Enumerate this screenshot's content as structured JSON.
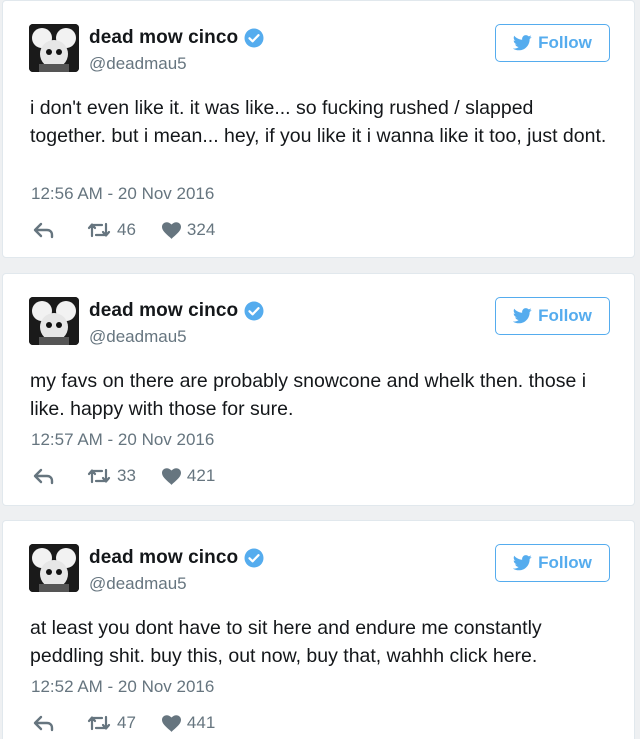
{
  "tweets": [
    {
      "name": "dead mow cinco",
      "handle": "@deadmau5",
      "follow_label": "Follow",
      "text": "i don't even like it. it was like... so fucking rushed / slapped together. but i mean... hey, if you like it i wanna like it too, just dont.",
      "timestamp": "12:56 AM - 20 Nov 2016",
      "retweets": "46",
      "likes": "324"
    },
    {
      "name": "dead mow cinco",
      "handle": "@deadmau5",
      "follow_label": "Follow",
      "text": "my favs on there are probably snowcone and whelk then. those i like. happy with those for sure.",
      "timestamp": "12:57 AM - 20 Nov 2016",
      "retweets": "33",
      "likes": "421"
    },
    {
      "name": "dead mow cinco",
      "handle": "@deadmau5",
      "follow_label": "Follow",
      "text": "at least you dont have to sit here and endure me constantly peddling shit. buy this, out now, buy that, wahhh click here.",
      "timestamp": "12:52 AM - 20 Nov 2016",
      "retweets": "47",
      "likes": "441"
    }
  ],
  "icons": {
    "verified": "verified-badge-icon",
    "follow": "twitter-bird-icon",
    "reply": "reply-icon",
    "retweet": "retweet-icon",
    "like": "heart-icon"
  },
  "colors": {
    "accent": "#55acee",
    "text": "#14171a",
    "muted": "#66757f",
    "background": "#eef0f2"
  }
}
